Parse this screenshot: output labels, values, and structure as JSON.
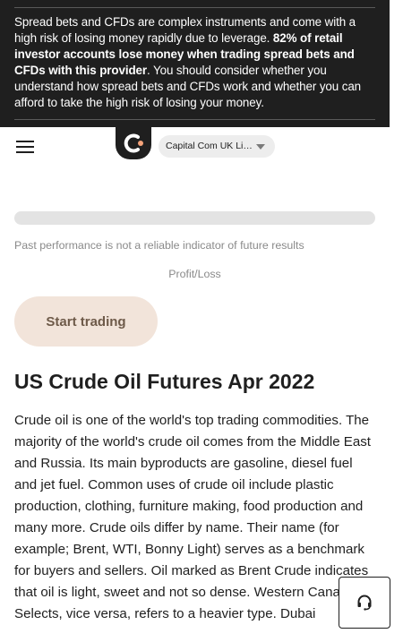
{
  "risk_banner": {
    "text_part1": "Spread bets and CFDs are complex instruments and come with a high risk of losing money rapidly due to leverage. ",
    "text_bold": "82% of retail investor accounts lose money when trading spread bets and CFDs with this provider",
    "text_part2": ". You should consider whether you understand how spread bets and CFDs work and whether you can afford to take the high risk of losing your money."
  },
  "navbar": {
    "menu_icon": "hamburger-icon",
    "logo_icon": "capital-com-logo",
    "entity_select": "Capital Com UK Limited",
    "caret_icon": "chevron-down-icon"
  },
  "chart": {
    "disclaimer": "Past performance is not a reliable indicator of future results",
    "profit_loss_label": "Profit/Loss"
  },
  "cta": {
    "label": "Start trading"
  },
  "article": {
    "title": "US Crude Oil Futures Apr 2022",
    "body": "Crude oil is one of the world's top trading commodities. The majority of the world's crude oil comes from the Middle East and Russia. Its main byproducts are gasoline, diesel fuel and jet fuel. Common uses of crude oil include plastic production, clothing, furniture making, food production and many more. Crude oils differ by name. Their name (for example; Brent, WTI, Bonny Light) serves as a benchmark for buyers and sellers. Oil marked as Brent Crude indicates that oil is light, sweet and not so dense. Western Canadian Selects, vice versa, refers to a heavier type. Dubai"
  },
  "support": {
    "icon": "headset-icon"
  },
  "colors": {
    "banner_bg": "#1f1f1f",
    "cta_bg": "#f2e4da",
    "cta_text": "#6e5a49",
    "logo_accent": "#f5a37a"
  }
}
